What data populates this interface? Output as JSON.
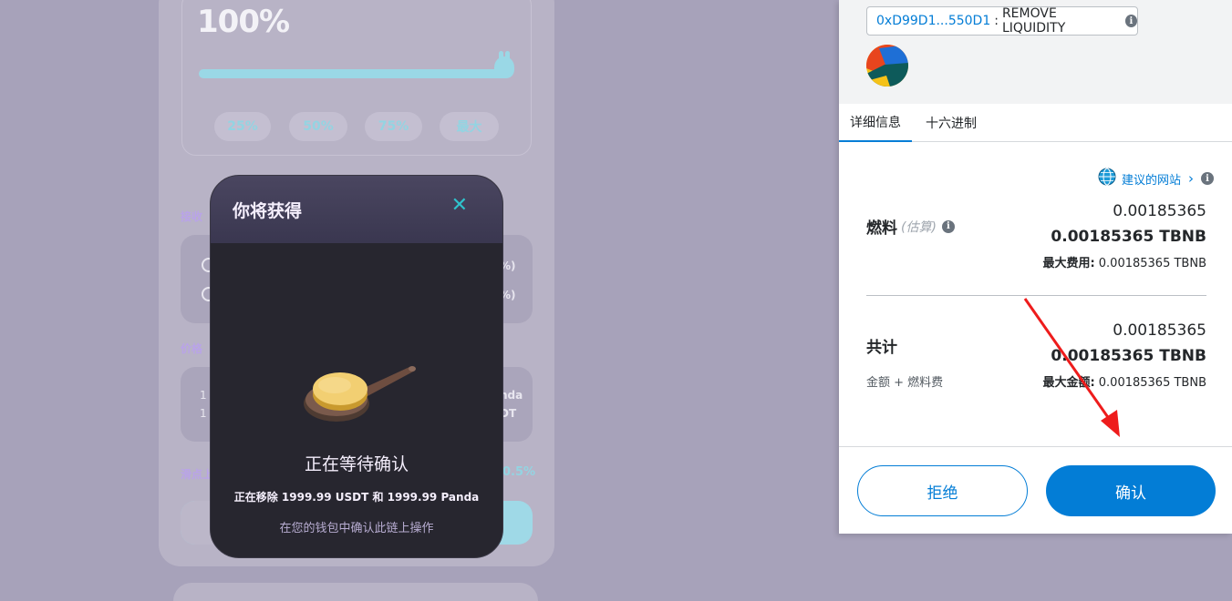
{
  "background": {
    "percent": "100%",
    "slider_value": 1.0,
    "percent_buttons": [
      "25%",
      "50%",
      "75%",
      "最大"
    ],
    "receive_label": "接收",
    "receive_rows": [
      "%)",
      "%)"
    ],
    "price_label": "价格",
    "price_rows": [
      {
        "left": "1 U",
        "right": "nda"
      },
      {
        "left": "1 P",
        "right": "DT"
      }
    ],
    "slippage_label": "滑点上",
    "slippage_value": "0.5%"
  },
  "modal": {
    "title": "你将获得",
    "close_icon": "close-icon",
    "status": "正在等待确认",
    "removing": "正在移除 1999.99 USDT 和 1999.99 Panda",
    "hint": "在您的钱包中确认此链上操作"
  },
  "wallet": {
    "address": "0xD99D1...550D1",
    "separator": ":",
    "method": "REMOVE LIQUIDITY",
    "tabs": [
      {
        "label": "详细信息",
        "active": true
      },
      {
        "label": "十六进制",
        "active": false
      }
    ],
    "site_link": "建议的网站",
    "gas": {
      "label": "燃料",
      "estimate": "(估算)",
      "amount": "0.00185365",
      "amount_bold": "0.00185365 TBNB",
      "max_fee_label": "最大费用:",
      "max_fee_value": "0.00185365 TBNB"
    },
    "total": {
      "label": "共计",
      "sub_label": "金额 + 燃料费",
      "amount": "0.00185365",
      "amount_bold": "0.00185365 TBNB",
      "max_amount_label": "最大金额:",
      "max_amount_value": "0.00185365 TBNB"
    },
    "reject_label": "拒绝",
    "confirm_label": "确认",
    "colors": {
      "accent": "#037dd6",
      "annotation_arrow": "#ee1c1c"
    }
  }
}
